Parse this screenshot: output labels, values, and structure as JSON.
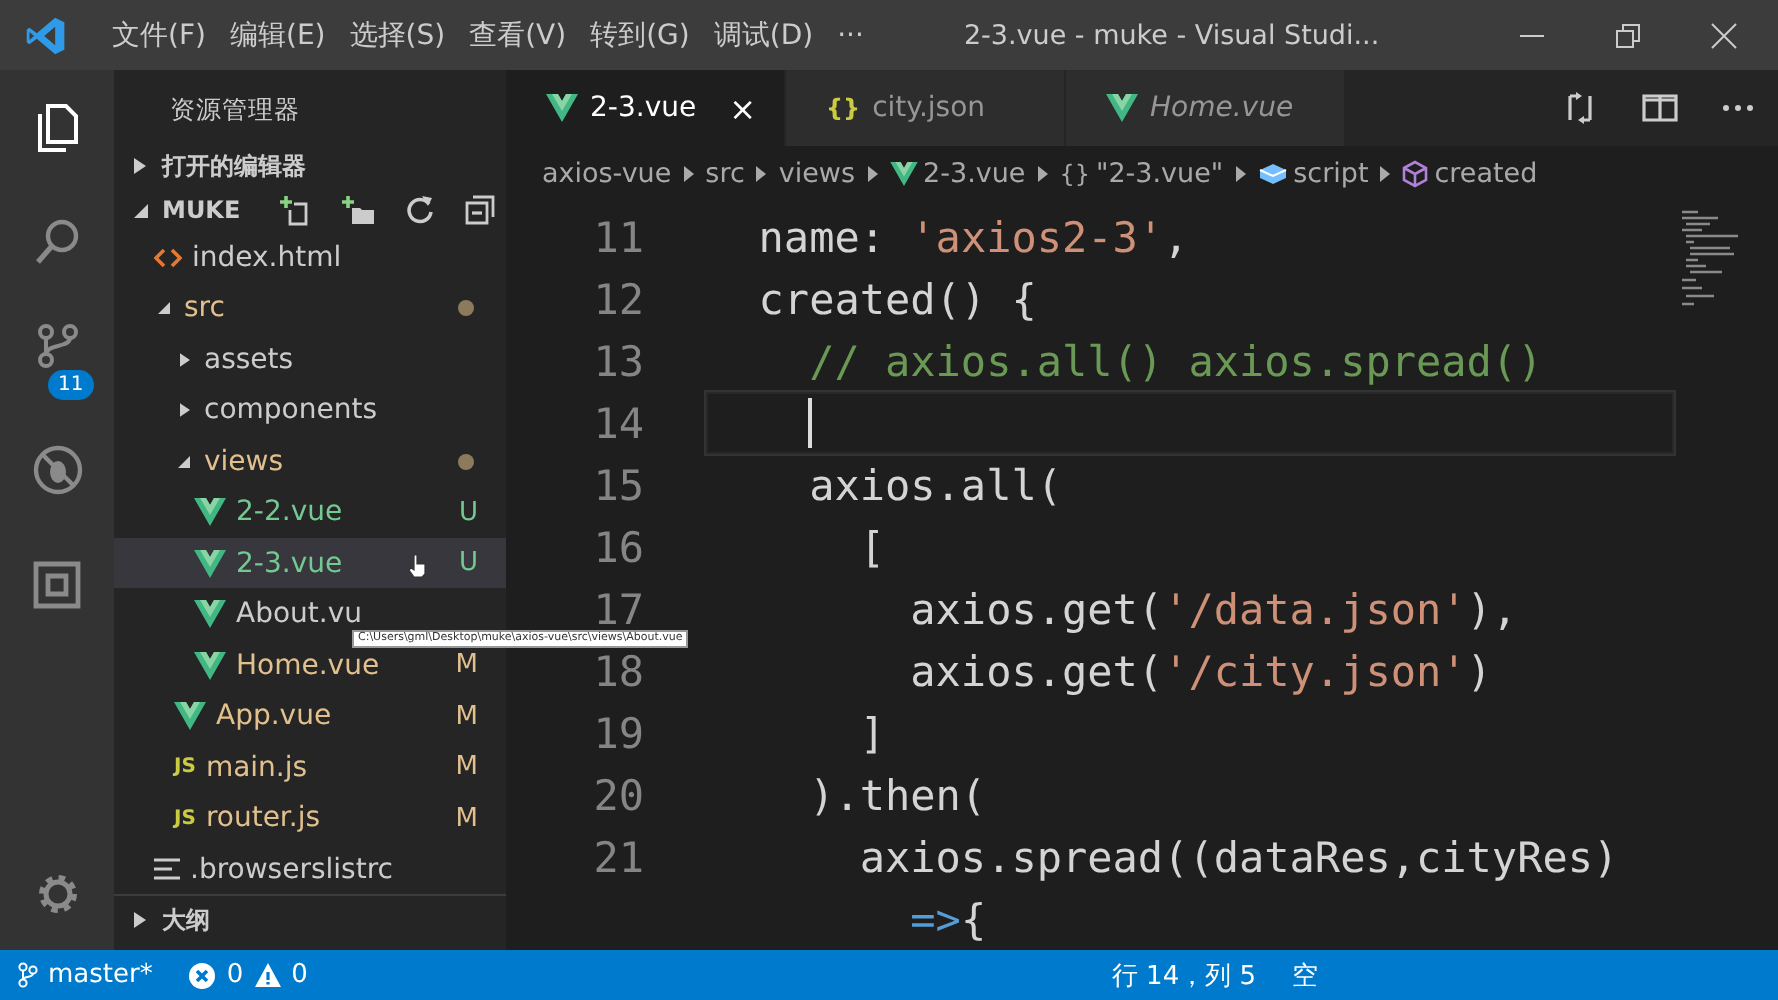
{
  "menu": [
    "文件(F)",
    "编辑(E)",
    "选择(S)",
    "查看(V)",
    "转到(G)",
    "调试(D)",
    "···"
  ],
  "window": {
    "title": "2-3.vue - muke - Visual Studi..."
  },
  "activity_bar": [
    {
      "kind": "files",
      "selected": true
    },
    {
      "kind": "search",
      "selected": false
    },
    {
      "kind": "source-control",
      "selected": false,
      "badge": "11"
    },
    {
      "kind": "debug",
      "selected": false
    },
    {
      "kind": "extensions",
      "selected": false
    }
  ],
  "sidebar": {
    "title": "资源管理器",
    "sections": [
      {
        "label": "打开的编辑器",
        "expanded": false
      },
      {
        "label": "MUKE",
        "expanded": true
      }
    ],
    "tree": [
      {
        "label": "index.html",
        "kind": "html",
        "selected": false
      },
      {
        "label": "src",
        "kind": "folder",
        "expanded": true,
        "modified_dot": true,
        "selected": false,
        "children": [
          {
            "label": "assets",
            "kind": "folder",
            "expanded": false,
            "selected": false
          },
          {
            "label": "components",
            "kind": "folder",
            "expanded": false,
            "selected": false
          },
          {
            "label": "views",
            "kind": "folder",
            "expanded": true,
            "modified_dot": true,
            "selected": false,
            "children": [
              {
                "label": "2-2.vue",
                "kind": "vue",
                "badge": "U",
                "color": "#73c991",
                "selected": false
              },
              {
                "label": "2-3.vue",
                "kind": "vue",
                "badge": "U",
                "color": "#73c991",
                "selected": true
              },
              {
                "label": "About.vu",
                "kind": "vue",
                "selected": false
              },
              {
                "label": "Home.vue",
                "kind": "vue",
                "badge": "M",
                "color": "#e2c08d",
                "selected": false
              }
            ]
          },
          {
            "label": "App.vue",
            "kind": "vue",
            "badge": "M",
            "color": "#e2c08d",
            "selected": false
          },
          {
            "label": "main.js",
            "kind": "js",
            "icon_text": "JS",
            "badge": "M",
            "color": "#e2c08d",
            "selected": false
          },
          {
            "label": "router.js",
            "kind": "js",
            "icon_text": "JS",
            "badge": "M",
            "color": "#e2c08d",
            "selected": false
          }
        ]
      },
      {
        "label": ".browserslistrc",
        "kind": "lines",
        "selected": false
      }
    ],
    "tooltip": "C:\\Users\\gml\\Desktop\\muke\\axios-vue\\src\\views\\About.vue",
    "outline": {
      "label": "大纲",
      "expanded": false
    }
  },
  "tabs": [
    {
      "label": "2-3.vue",
      "kind": "vue",
      "selected": true,
      "italic": false,
      "close": "×"
    },
    {
      "label": "city.json",
      "kind": "json",
      "icon_text": "{}",
      "selected": false,
      "italic": false
    },
    {
      "label": "Home.vue",
      "kind": "vue",
      "selected": false,
      "italic": true
    }
  ],
  "breadcrumbs": [
    {
      "label": "axios-vue",
      "kind": "text"
    },
    {
      "label": "src",
      "kind": "text"
    },
    {
      "label": "views",
      "kind": "text"
    },
    {
      "label": "2-3.vue",
      "kind": "vue"
    },
    {
      "label": "\"2-3.vue\"",
      "kind": "braces",
      "icon_text": "{}"
    },
    {
      "label": "script",
      "kind": "cube"
    },
    {
      "label": "created",
      "kind": "method"
    }
  ],
  "code": [
    {
      "number": "11",
      "current": false,
      "tokens": [
        {
          "text": "  name: ",
          "kind": "plain"
        },
        {
          "text": "'axios2-3'",
          "kind": "string"
        },
        {
          "text": ",",
          "kind": "plain"
        }
      ]
    },
    {
      "number": "12",
      "current": false,
      "tokens": [
        {
          "text": "  created() {",
          "kind": "plain"
        }
      ]
    },
    {
      "number": "13",
      "current": false,
      "tokens": [
        {
          "text": "    // axios.all() axios.spread()",
          "kind": "comment"
        }
      ]
    },
    {
      "number": "14",
      "current": true
    },
    {
      "number": "15",
      "current": false,
      "tokens": [
        {
          "text": "    axios.all(",
          "kind": "plain"
        }
      ]
    },
    {
      "number": "16",
      "current": false,
      "tokens": [
        {
          "text": "      [",
          "kind": "plain"
        }
      ]
    },
    {
      "number": "17",
      "current": false,
      "tokens": [
        {
          "text": "        axios.get(",
          "kind": "plain"
        },
        {
          "text": "'/data.json'",
          "kind": "string"
        },
        {
          "text": "),",
          "kind": "plain"
        }
      ]
    },
    {
      "number": "18",
      "current": false,
      "tokens": [
        {
          "text": "        axios.get(",
          "kind": "plain"
        },
        {
          "text": "'/city.json'",
          "kind": "string"
        },
        {
          "text": ")",
          "kind": "plain"
        }
      ]
    },
    {
      "number": "19",
      "current": false,
      "tokens": [
        {
          "text": "      ]",
          "kind": "plain"
        }
      ]
    },
    {
      "number": "20",
      "current": false,
      "tokens": [
        {
          "text": "    ).then(",
          "kind": "plain"
        }
      ]
    },
    {
      "number": "21",
      "current": false,
      "tokens": [
        {
          "text": "      axios.spread((dataRes,cityRes)",
          "kind": "plain"
        }
      ]
    },
    {
      "current": false,
      "tokens": [
        {
          "text": "        =>",
          "kind": "keyword"
        },
        {
          "text": "{",
          "kind": "plain"
        }
      ]
    }
  ],
  "status_bar": {
    "branch": "master*",
    "errors": "0",
    "warnings": "0",
    "position": "行 14，列 5",
    "indent": "空"
  }
}
